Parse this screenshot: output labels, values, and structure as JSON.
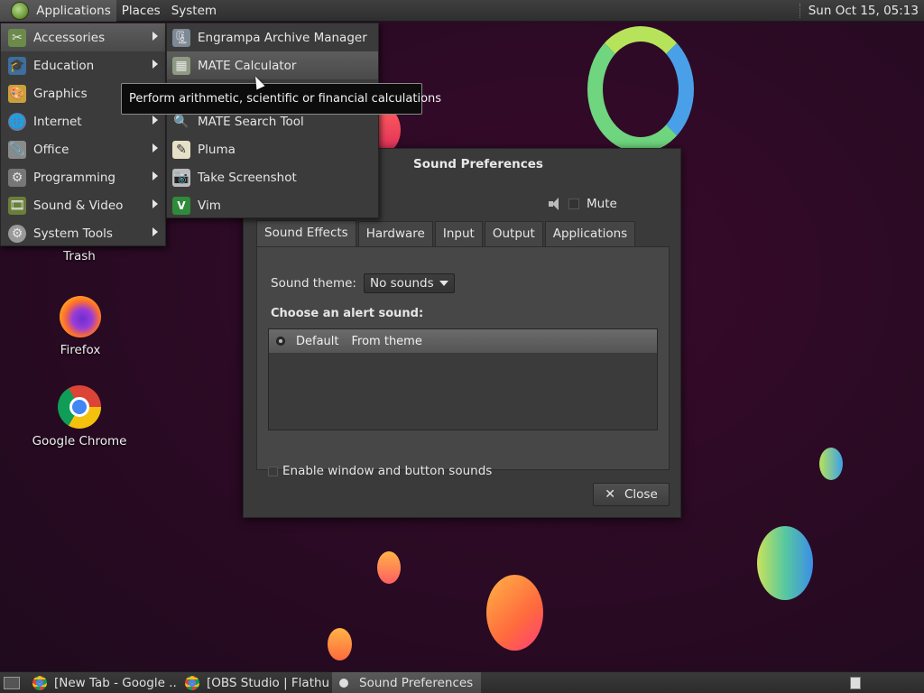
{
  "top_panel": {
    "menus": [
      "Applications",
      "Places",
      "System"
    ],
    "clock": "Sun Oct 15, 05:13"
  },
  "colors": {
    "wallpaper": "#2c0a25",
    "menu_bg": "#3b3b3b",
    "highlight": "#555555"
  },
  "desktop": {
    "icons": [
      {
        "label": "Trash",
        "icon": "trash-icon"
      },
      {
        "label": "Firefox",
        "icon": "firefox-icon"
      },
      {
        "label": "Google Chrome",
        "icon": "chrome-icon"
      }
    ]
  },
  "menu": {
    "categories": [
      {
        "label": "Accessories",
        "icon": "accessories-icon"
      },
      {
        "label": "Education",
        "icon": "education-icon"
      },
      {
        "label": "Graphics",
        "icon": "graphics-icon"
      },
      {
        "label": "Internet",
        "icon": "internet-icon"
      },
      {
        "label": "Office",
        "icon": "office-icon"
      },
      {
        "label": "Programming",
        "icon": "programming-icon"
      },
      {
        "label": "Sound & Video",
        "icon": "sound-video-icon"
      },
      {
        "label": "System Tools",
        "icon": "system-tools-icon"
      }
    ],
    "submenu": [
      {
        "label": "Engrampa Archive Manager",
        "icon": "archive-icon"
      },
      {
        "label": "MATE Calculator",
        "icon": "calculator-icon"
      },
      {
        "label": "",
        "icon": ""
      },
      {
        "label": "MATE Search Tool",
        "icon": "search-icon"
      },
      {
        "label": "Pluma",
        "icon": "text-editor-icon"
      },
      {
        "label": "Take Screenshot",
        "icon": "screenshot-icon"
      },
      {
        "label": "Vim",
        "icon": "vim-icon"
      }
    ],
    "tooltip": "Perform arithmetic, scientific or financial calculations"
  },
  "dialog": {
    "title": "Sound Preferences",
    "mute_label": "Mute",
    "tabs": [
      "Sound Effects",
      "Hardware",
      "Input",
      "Output",
      "Applications"
    ],
    "sound_theme_label": "Sound theme:",
    "sound_theme_value": "No sounds",
    "alert_heading": "Choose an alert sound:",
    "alert_rows": [
      {
        "name": "Default",
        "source": "From theme"
      }
    ],
    "enable_sounds_label": "Enable window and button sounds",
    "close_label": "Close"
  },
  "taskbar": {
    "tasks": [
      {
        "label": "[New Tab - Google ...",
        "icon": "chrome-icon"
      },
      {
        "label": "[OBS Studio | Flathu...",
        "icon": "chrome-icon"
      },
      {
        "label": "Sound Preferences",
        "icon": "dialog-icon"
      }
    ]
  }
}
